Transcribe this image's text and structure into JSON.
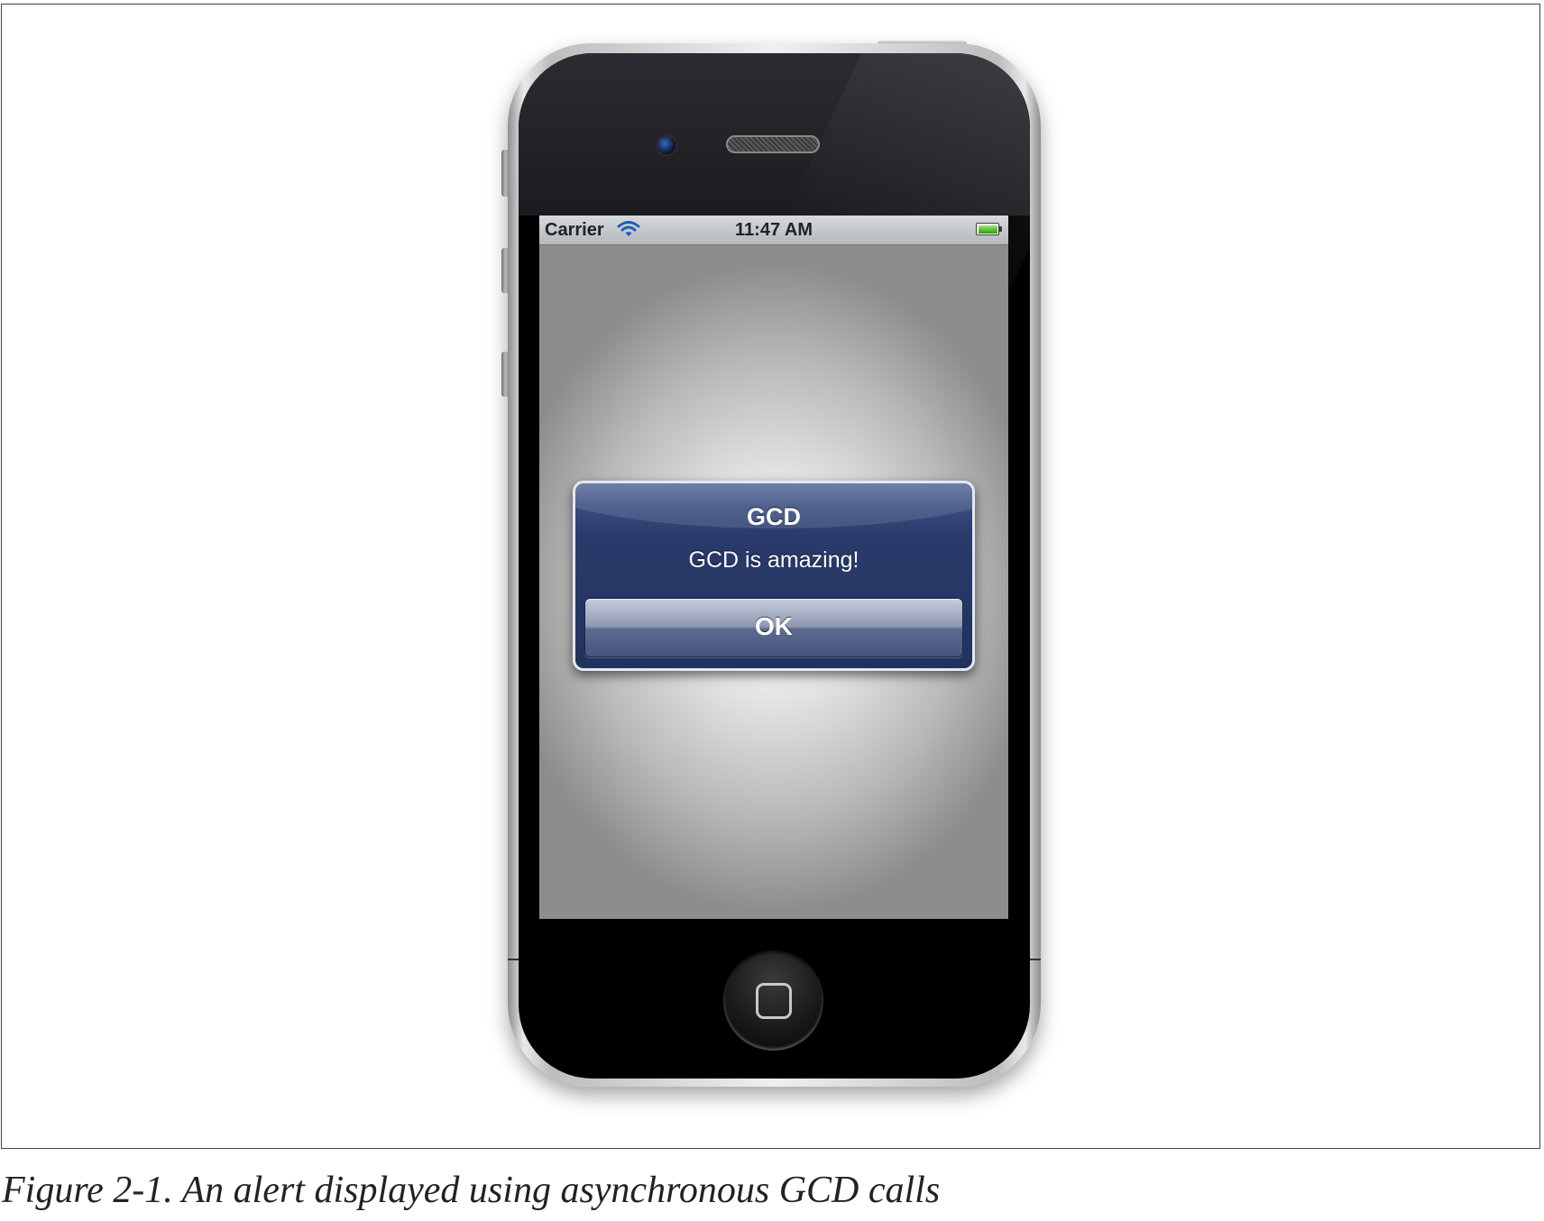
{
  "status_bar": {
    "carrier": "Carrier",
    "time": "11:47 AM",
    "wifi_icon": "wifi-icon",
    "battery_icon": "battery-icon",
    "battery_level": 1.0
  },
  "alert": {
    "title": "GCD",
    "message": "GCD is amazing!",
    "button_label": "OK"
  },
  "device": {
    "home_icon": "home-button-icon",
    "camera_icon": "camera-icon",
    "speaker_icon": "speaker-icon"
  },
  "caption": "Figure 2-1. An alert displayed using asynchronous GCD calls",
  "colors": {
    "alert_background": "#22325e",
    "battery_fill": "#2f9e13",
    "status_bar": "#b4b8bb"
  }
}
